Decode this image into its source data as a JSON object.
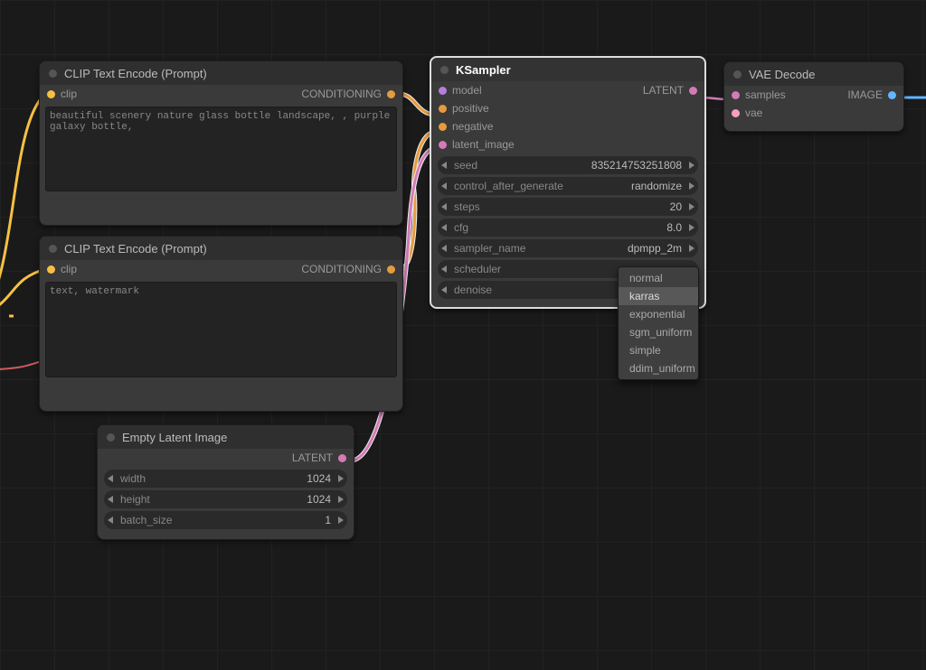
{
  "colors": {
    "yellow": "#f6c142",
    "orange": "#e69b3d",
    "purple": "#b57edc",
    "pinkalt": "#d37ab7",
    "pink": "#f79fc0",
    "blue": "#63b6ff",
    "gray": "#888888"
  },
  "clip_pos": {
    "title": "CLIP Text Encode (Prompt)",
    "in_clip": "clip",
    "out_cond": "CONDITIONING",
    "prompt": "beautiful scenery nature glass bottle landscape, , purple galaxy bottle,"
  },
  "clip_neg": {
    "title": "CLIP Text Encode (Prompt)",
    "in_clip": "clip",
    "out_cond": "CONDITIONING",
    "prompt": "text, watermark"
  },
  "empty_latent": {
    "title": "Empty Latent Image",
    "out_latent": "LATENT",
    "width_label": "width",
    "width_val": "1024",
    "height_label": "height",
    "height_val": "1024",
    "batch_label": "batch_size",
    "batch_val": "1"
  },
  "ksampler": {
    "title": "KSampler",
    "in_model": "model",
    "in_positive": "positive",
    "in_negative": "negative",
    "in_latent": "latent_image",
    "out_latent": "LATENT",
    "seed_label": "seed",
    "seed_val": "835214753251808",
    "cag_label": "control_after_generate",
    "cag_val": "randomize",
    "steps_label": "steps",
    "steps_val": "20",
    "cfg_label": "cfg",
    "cfg_val": "8.0",
    "sname_label": "sampler_name",
    "sname_val": "dpmpp_2m",
    "sched_label": "scheduler",
    "denoise_label": "denoise"
  },
  "vae_decode": {
    "title": "VAE Decode",
    "in_samples": "samples",
    "in_vae": "vae",
    "out_image": "IMAGE"
  },
  "scheduler_menu": {
    "items": [
      "normal",
      "karras",
      "exponential",
      "sgm_uniform",
      "simple",
      "ddim_uniform"
    ],
    "selected": "karras"
  }
}
